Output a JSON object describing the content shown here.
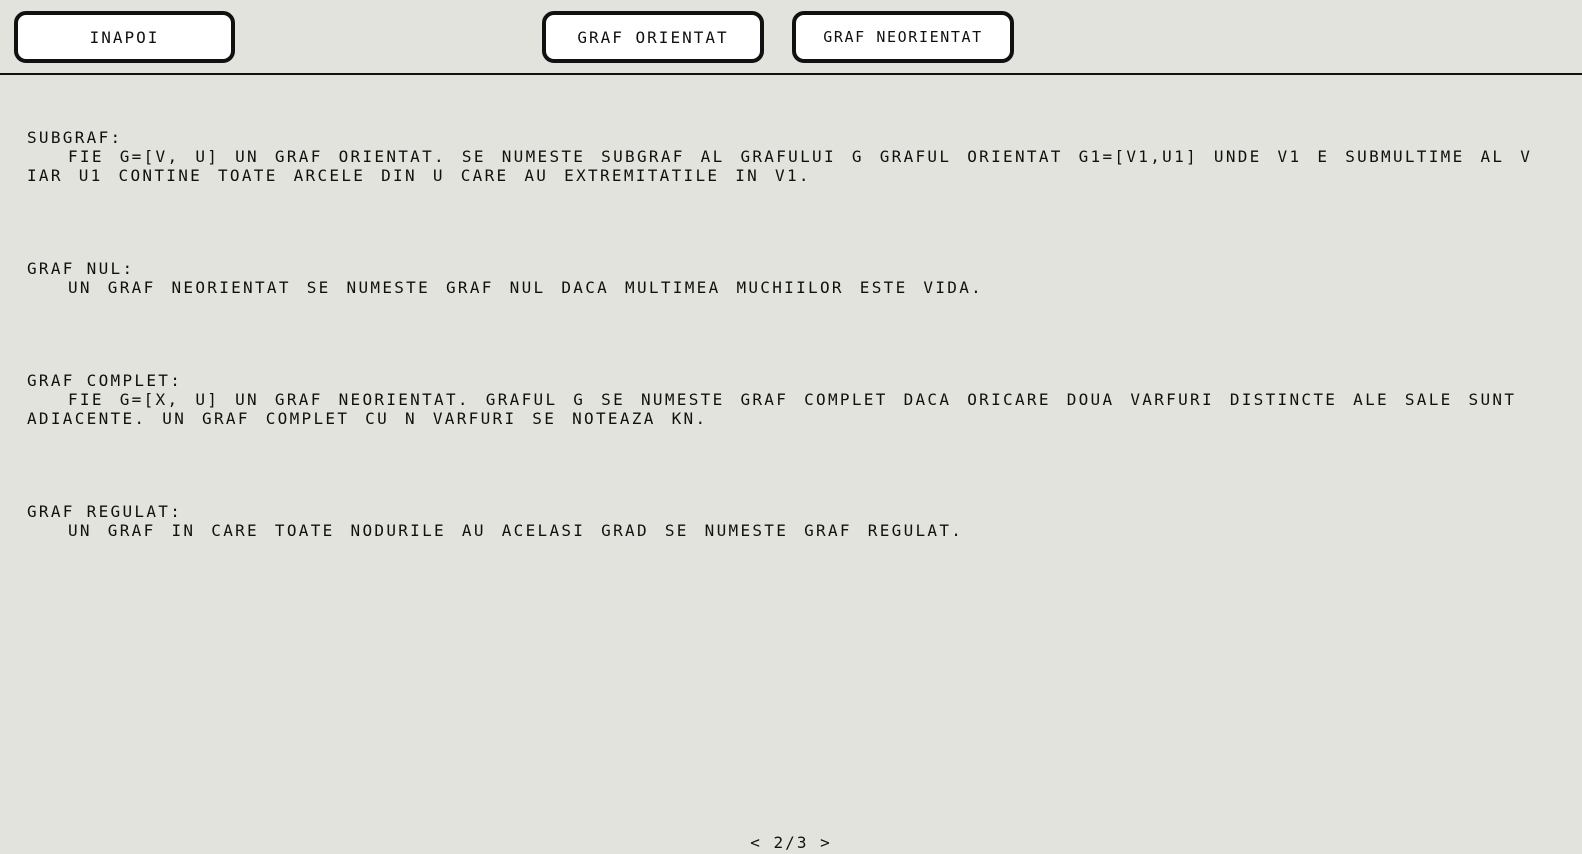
{
  "toolbar": {
    "back_label": "INAPOI",
    "directed_label": "GRAF ORIENTAT",
    "undirected_label": "GRAF NEORIENTAT"
  },
  "sections": [
    {
      "title": "SUBGRAF:",
      "body": "FIE G=[V, U] UN GRAF ORIENTAT. SE NUMESTE SUBGRAF AL GRAFULUI G GRAFUL ORIENTAT G1=[V1,U1] UNDE V1 E SUBMULTIME AL V IAR U1 CONTINE TOATE ARCELE DIN U CARE AU EXTREMITATILE IN V1."
    },
    {
      "title": "GRAF NUL:",
      "body": "UN GRAF NEORIENTAT SE NUMESTE GRAF NUL DACA MULTIMEA MUCHIILOR ESTE VIDA."
    },
    {
      "title": "GRAF COMPLET:",
      "body": "FIE G=[X, U] UN GRAF NEORIENTAT. GRAFUL G SE NUMESTE GRAF COMPLET DACA ORICARE DOUA VARFURI DISTINCTE ALE SALE SUNT ADIACENTE. UN GRAF COMPLET CU N VARFURI SE NOTEAZA KN."
    },
    {
      "title": "GRAF REGULAT:",
      "body": "UN GRAF IN CARE TOATE NODURILE AU ACELASI GRAD SE NUMESTE GRAF REGULAT."
    }
  ],
  "pager": {
    "prev_label": "<",
    "page_label": "2/3",
    "next_label": ">"
  }
}
